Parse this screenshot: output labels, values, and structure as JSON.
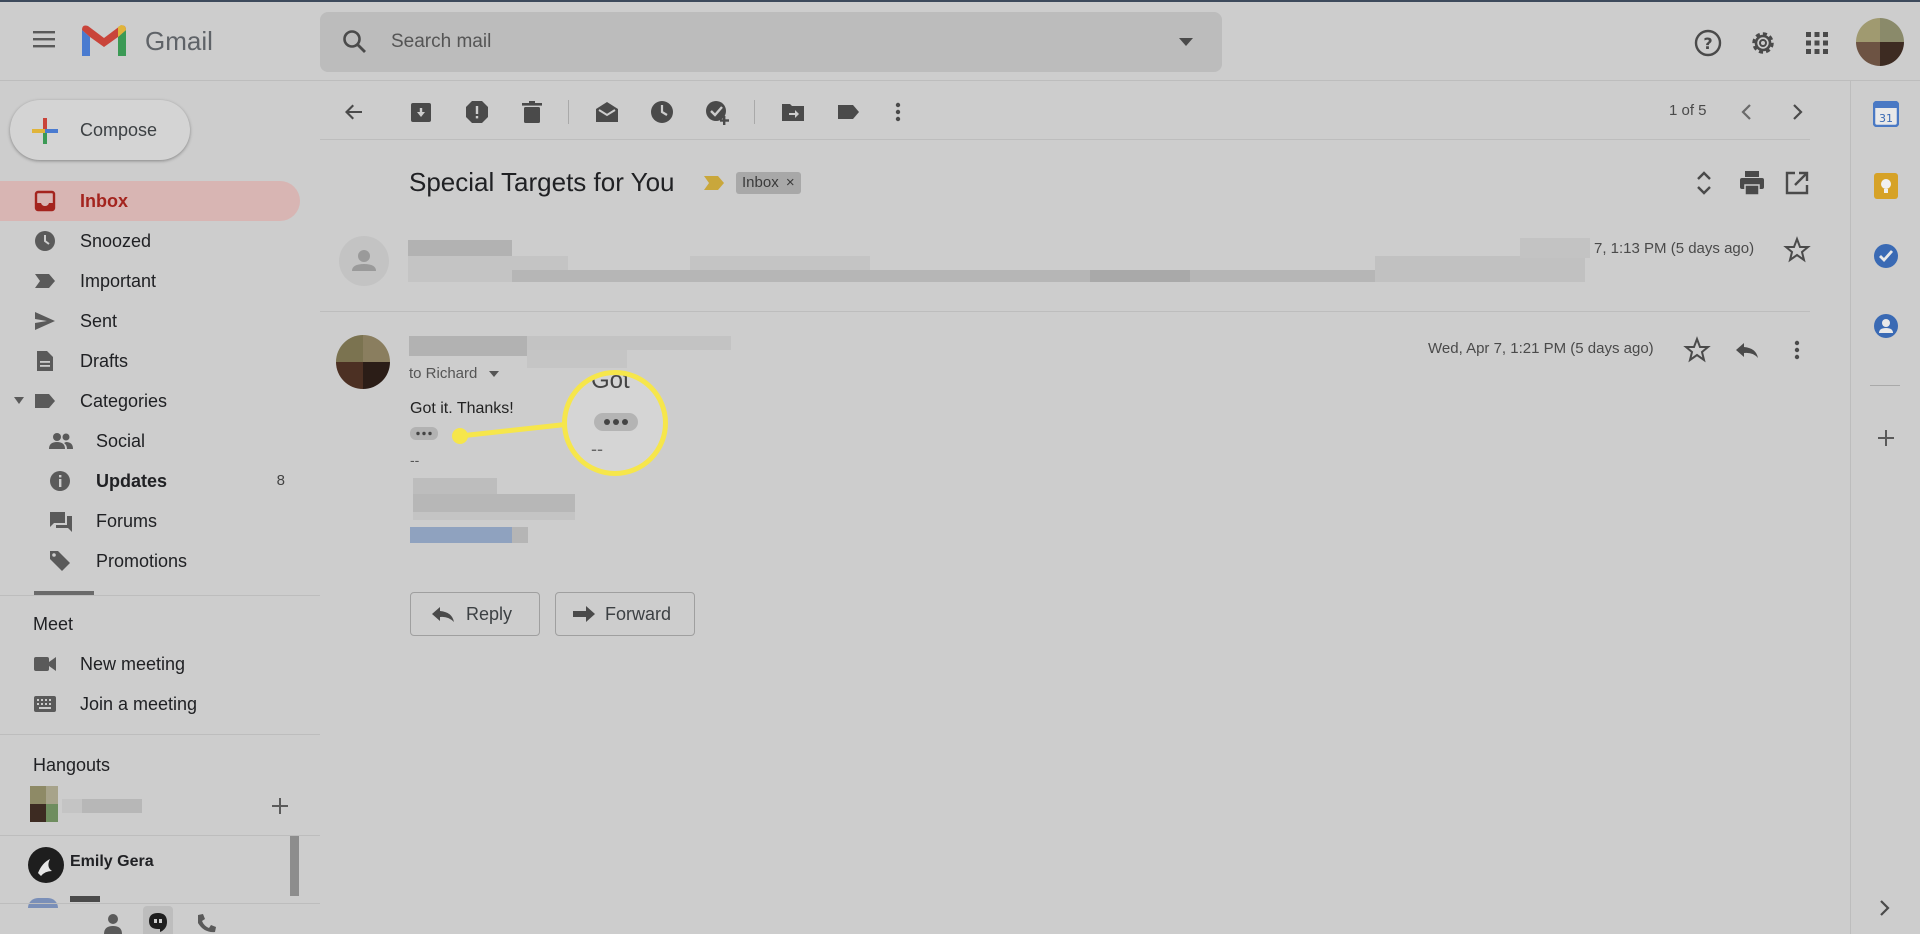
{
  "app": {
    "name": "Gmail"
  },
  "search": {
    "placeholder": "Search mail"
  },
  "compose": {
    "label": "Compose"
  },
  "nav": [
    {
      "label": "Inbox",
      "icon": "inbox-icon",
      "active": true
    },
    {
      "label": "Snoozed",
      "icon": "clock-icon"
    },
    {
      "label": "Important",
      "icon": "important-icon"
    },
    {
      "label": "Sent",
      "icon": "send-icon"
    },
    {
      "label": "Drafts",
      "icon": "draft-icon"
    },
    {
      "label": "Categories",
      "icon": "label-icon"
    },
    {
      "label": "Social",
      "icon": "people-icon"
    },
    {
      "label": "Updates",
      "icon": "info-icon",
      "count": "8"
    },
    {
      "label": "Forums",
      "icon": "forum-icon"
    },
    {
      "label": "Promotions",
      "icon": "tag-icon"
    }
  ],
  "meet": {
    "title": "Meet",
    "new_meeting": "New meeting",
    "join": "Join a meeting"
  },
  "hangouts": {
    "title": "Hangouts",
    "contact": "Emily Gera"
  },
  "toolbar": {
    "pagination": "1 of 5"
  },
  "email": {
    "subject": "Special Targets for You",
    "label_chip": "Inbox",
    "label_close": "×",
    "first_date": "7, 1:13 PM (5 days ago)",
    "second_date": "Wed, Apr 7, 1:21 PM (5 days ago)",
    "to": "to Richard",
    "body": "Got it. Thanks!",
    "signature_sep": "--",
    "zoom_text": "Got",
    "zoom_sep": "--"
  },
  "actions": {
    "reply": "Reply",
    "forward": "Forward"
  },
  "colors": {
    "accent_callout": "#f6e64b",
    "inbox_active": "#a4241e"
  }
}
